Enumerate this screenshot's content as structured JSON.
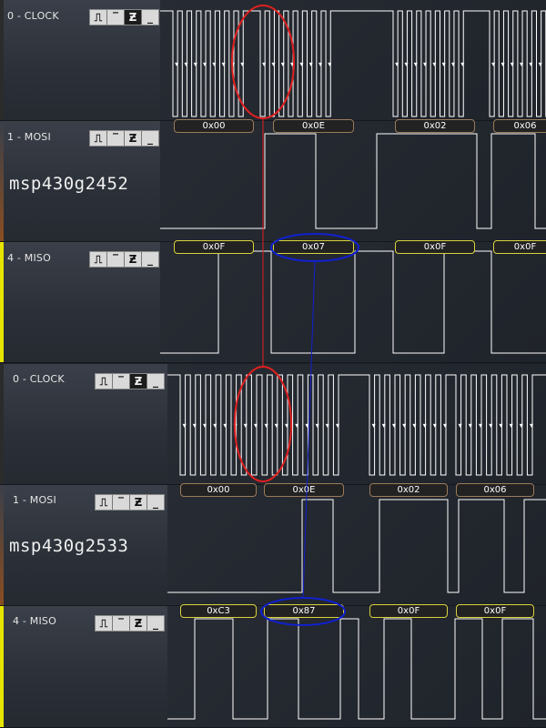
{
  "rows": [
    {
      "channel_label": "0 - CLOCK",
      "kind": "clock",
      "strip_color": "#2b2b2b"
    },
    {
      "channel_label": "1 - MOSI",
      "kind": "mosi",
      "strip_color": "#8a4e22",
      "chip_label": "msp430g2452",
      "decodes": [
        "0x00",
        "0x0E",
        "0x02",
        "0x06"
      ]
    },
    {
      "channel_label": "4 - MISO",
      "kind": "miso",
      "strip_color": "#e6e400",
      "decodes": [
        "0x0F",
        "0x07",
        "0x0F",
        "0x0F"
      ]
    },
    {
      "channel_label": "0 - CLOCK",
      "kind": "clock",
      "strip_color": "#2b2b2b"
    },
    {
      "channel_label": "1 - MOSI",
      "kind": "mosi",
      "strip_color": "#8a4e22",
      "chip_label": "msp430g2533",
      "decodes": [
        "0x00",
        "0x0E",
        "0x02",
        "0x06"
      ]
    },
    {
      "channel_label": "4 - MISO",
      "kind": "miso",
      "strip_color": "#e6e400",
      "decodes": [
        "0xC3",
        "0x87",
        "0x0F",
        "0x0F"
      ]
    }
  ],
  "trigger_buttons": [
    "rising-edge",
    "high-level",
    "falling-edge",
    "low-level"
  ],
  "colors": {
    "signal": "#ffffff",
    "highlight_red": "#e02020",
    "highlight_blue": "#1020d0"
  }
}
